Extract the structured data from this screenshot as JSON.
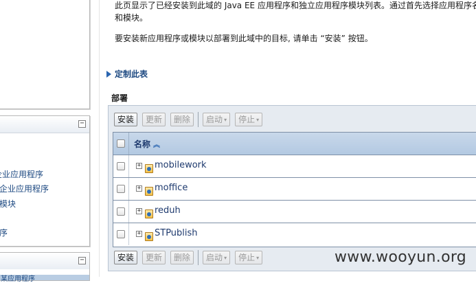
{
  "description": {
    "line1": "此页显示了已经安装到此域的 Java EE 应用程序和独立应用程序模块列表。通过首先选择应用程序名",
    "line2": "和模块。",
    "line3": "要安装新应用程序或模块以部署到此域中的目标, 请单击 “安装” 按钮。"
  },
  "customize_link": "定制此表",
  "section_title": "部署",
  "toolbar": {
    "install": "安装",
    "update": "更新",
    "delete": "删除",
    "start": "启动",
    "stop": "停止"
  },
  "table": {
    "column_name": "名称",
    "rows": [
      {
        "name": "mobilework"
      },
      {
        "name": "moffice"
      },
      {
        "name": "reduh"
      },
      {
        "name": "STPublish"
      }
    ]
  },
  "sidebar": {
    "links": [
      "企业应用程序",
      "企业应用程序",
      "模块",
      "序"
    ],
    "bottom_strip_text": "某应用程序"
  },
  "watermark": "www.wooyun.org",
  "icons": {
    "collapse": "collapse-icon",
    "customize": "triangle-right-icon",
    "sort": "sort-ascending-icon",
    "expand": "plus-square-icon",
    "app": "application-icon"
  }
}
